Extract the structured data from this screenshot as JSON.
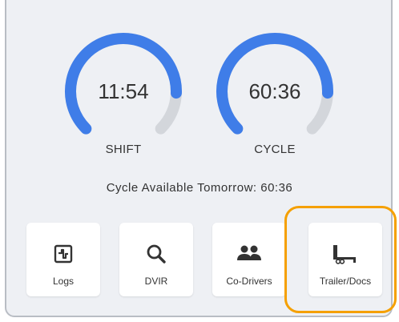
{
  "gauges": [
    {
      "value": "11:54",
      "label": "SHIFT",
      "fill_fraction": 0.84
    },
    {
      "value": "60:36",
      "label": "CYCLE",
      "fill_fraction": 0.84
    }
  ],
  "cycle_available_text": "Cycle Available Tomorrow: 60:36",
  "tiles": [
    {
      "label": "Logs",
      "icon": "logs-icon"
    },
    {
      "label": "DVIR",
      "icon": "search-icon"
    },
    {
      "label": "Co-Drivers",
      "icon": "people-icon"
    },
    {
      "label": "Trailer/Docs",
      "icon": "trailer-icon"
    }
  ],
  "colors": {
    "gauge_active": "#3f7de8",
    "gauge_track": "#d3d6db",
    "highlight": "#f5a000",
    "panel_bg": "#eef0f4"
  }
}
